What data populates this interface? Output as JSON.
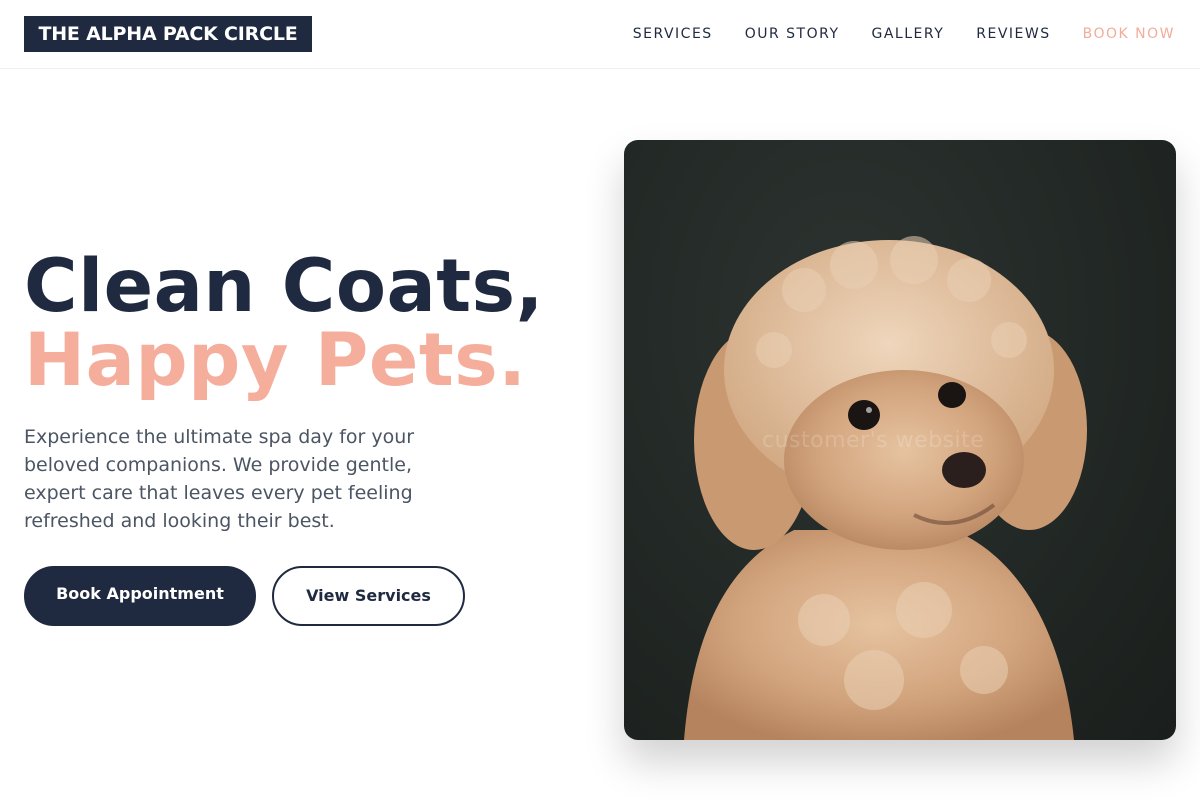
{
  "header": {
    "logo": "THE ALPHA PACK CIRCLE",
    "nav": [
      {
        "label": "SERVICES"
      },
      {
        "label": "OUR STORY"
      },
      {
        "label": "GALLERY"
      },
      {
        "label": "REVIEWS"
      },
      {
        "label": "BOOK NOW"
      }
    ]
  },
  "hero": {
    "title_line1": "Clean Coats,",
    "title_line2": "Happy Pets.",
    "description": "Experience the ultimate spa day for your beloved companions. We provide gentle, expert care that leaves every pet feeling refreshed and looking their best.",
    "primary_button": "Book Appointment",
    "secondary_button": "View Services",
    "image_watermark": "customer's website"
  },
  "colors": {
    "navy": "#1f2a40",
    "peach": "#f6ae9c",
    "text_gray": "#4b5563"
  }
}
